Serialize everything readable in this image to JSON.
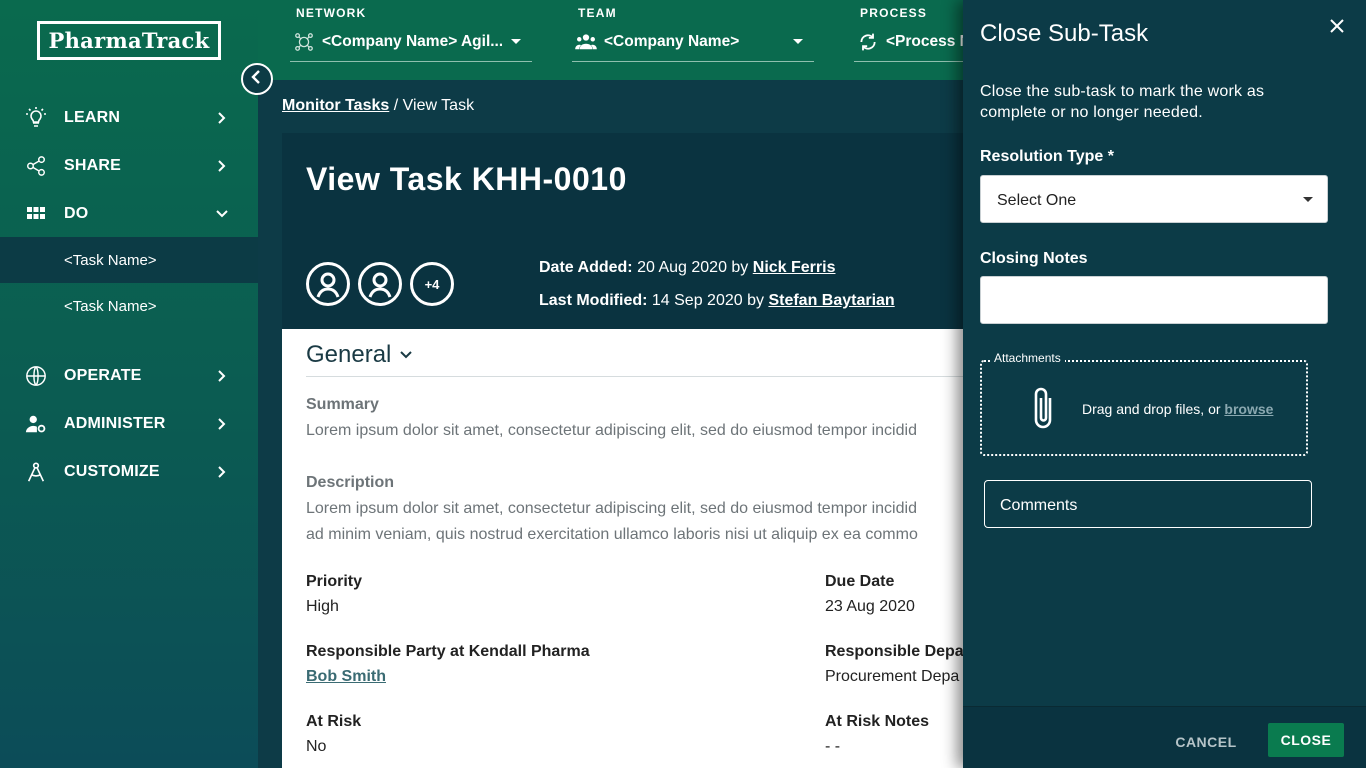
{
  "app": {
    "logo": "PharmaTrack"
  },
  "topbar": {
    "network": {
      "label": "NETWORK",
      "value": "<Company Name> Agil..."
    },
    "team": {
      "label": "TEAM",
      "value": "<Company Name>"
    },
    "process": {
      "label": "PROCESS",
      "value": "<Process N"
    }
  },
  "sidebar": {
    "items": [
      {
        "label": "LEARN",
        "icon": "lightbulb-icon"
      },
      {
        "label": "SHARE",
        "icon": "share-icon"
      },
      {
        "label": "DO",
        "icon": "grid-icon"
      },
      {
        "label": "OPERATE",
        "icon": "globe-icon"
      },
      {
        "label": "ADMINISTER",
        "icon": "user-gear-icon"
      },
      {
        "label": "CUSTOMIZE",
        "icon": "compass-icon"
      }
    ],
    "subitems": [
      {
        "label": "<Task Name>"
      },
      {
        "label": "<Task Name>"
      }
    ]
  },
  "breadcrumb": {
    "parent": "Monitor Tasks",
    "separator": " / ",
    "current": "View Task"
  },
  "task": {
    "title": "View Task KHH-0010",
    "avatars_more": "+4",
    "date_added_label": "Date Added:",
    "date_added": "20 Aug 2020 by",
    "added_by": "Nick Ferris",
    "last_modified_label": "Last Modified:",
    "last_modified": "14 Sep 2020 by",
    "modified_by": "Stefan Baytarian"
  },
  "general": {
    "title": "General",
    "summary_label": "Summary",
    "summary": "Lorem ipsum dolor sit amet, consectetur adipiscing elit, sed do eiusmod tempor incidid",
    "description_label": "Description",
    "description_line1": "Lorem ipsum dolor sit amet, consectetur adipiscing elit, sed do eiusmod tempor incidid",
    "description_line2": "ad minim veniam, quis nostrud exercitation ullamco laboris nisi ut aliquip ex ea commo",
    "priority_label": "Priority",
    "priority": "High",
    "due_date_label": "Due Date",
    "due_date": "23 Aug 2020",
    "responsible_party_label": "Responsible Party at Kendall Pharma",
    "responsible_party": "Bob Smith",
    "responsible_dept_label": "Responsible Depar",
    "responsible_dept": "Procurement Depa",
    "at_risk_label": "At Risk",
    "at_risk": "No",
    "at_risk_notes_label": "At Risk Notes",
    "at_risk_notes": "- -"
  },
  "drawer": {
    "title": "Close Sub-Task",
    "description": "Close the sub-task to mark the work as complete or no longer needed.",
    "resolution_label": "Resolution Type *",
    "resolution_value": "Select One",
    "closing_notes_label": "Closing Notes",
    "attachments_label": "Attachments",
    "drop_text": "Drag and drop files, or ",
    "browse": "browse",
    "comments": "Comments",
    "cancel": "CANCEL",
    "close": "CLOSE"
  },
  "colors": {
    "brand_green": "#0a6a4e",
    "dark_teal": "#0d3b47",
    "primary_button": "#0a7b4f"
  }
}
